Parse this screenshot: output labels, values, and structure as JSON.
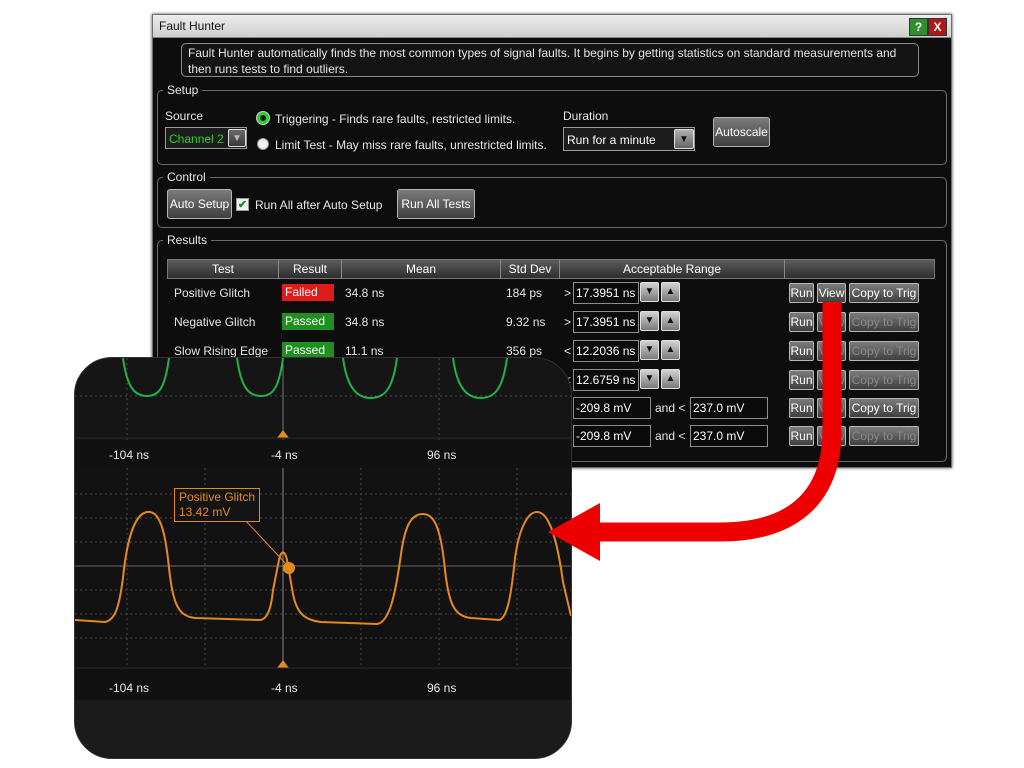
{
  "window": {
    "title": "Fault Hunter",
    "help_label": "?",
    "close_label": "X",
    "description": "Fault Hunter automatically finds the most common types of signal faults. It begins by getting statistics on standard measurements and then runs tests to find outliers."
  },
  "setup": {
    "group_label": "Setup",
    "source_label": "Source",
    "source_value": "Channel 2",
    "option_triggering": "Triggering - Finds rare faults, restricted limits.",
    "option_limit": "Limit Test - May miss rare faults, unrestricted limits.",
    "duration_label": "Duration",
    "duration_value": "Run for a minute",
    "autoscale_label": "Autoscale"
  },
  "control": {
    "group_label": "Control",
    "auto_setup_label": "Auto Setup",
    "run_all_after_label": "Run All after Auto Setup",
    "run_all_tests_label": "Run All Tests"
  },
  "results": {
    "group_label": "Results",
    "columns": [
      "Test",
      "Result",
      "Mean",
      "Std Dev",
      "Acceptable Range"
    ],
    "rows": [
      {
        "test": "Positive Glitch",
        "result": "Failed",
        "mean": "34.8 ns",
        "std": "184 ps",
        "op": ">",
        "range": "17.3951 ns"
      },
      {
        "test": "Negative Glitch",
        "result": "Passed",
        "mean": "34.8 ns",
        "std": "9.32 ns",
        "op": ">",
        "range": "17.3951 ns"
      },
      {
        "test": "Slow Rising Edge",
        "result": "Passed",
        "mean": "11.1 ns",
        "std": "356 ps",
        "op": "<",
        "range": "12.2036 ns"
      },
      {
        "op": "<",
        "range": "12.6759 ns"
      },
      {
        "low": "-209.8 mV",
        "and": "and <",
        "high": "237.0 mV"
      },
      {
        "low": "-209.8 mV",
        "and": "and <",
        "high": "237.0 mV"
      }
    ],
    "run_label": "Run",
    "view_label": "View",
    "copy_label": "Copy to Trig"
  },
  "scope": {
    "ticks_top": [
      "-104 ns",
      "-4 ns",
      "96 ns"
    ],
    "ticks_bottom": [
      "-104 ns",
      "-4 ns",
      "96 ns"
    ],
    "marker_title": "Positive Glitch",
    "marker_value": "13.42 mV",
    "colors": {
      "green_trace": "#22b24c",
      "orange_trace": "#e38a1e",
      "arrow": "#ee0000"
    }
  }
}
